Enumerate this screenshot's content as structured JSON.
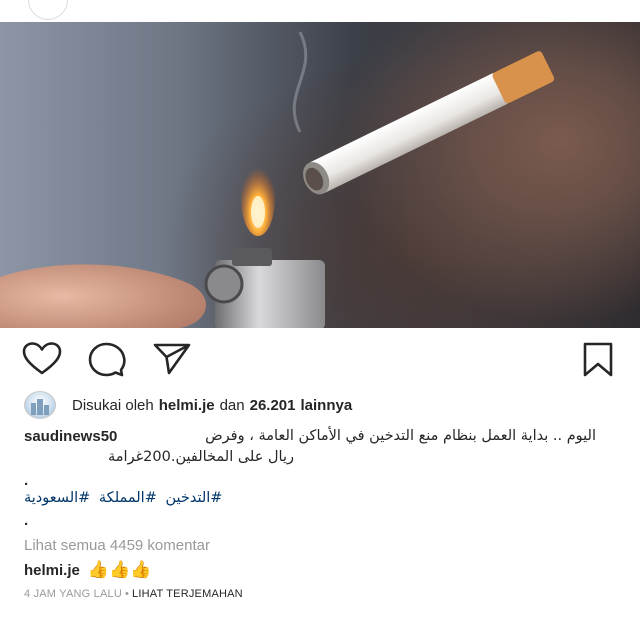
{
  "post": {
    "liked_by_prefix": "Disukai oleh",
    "liked_by_user": "helmi.je",
    "liked_by_and": "dan",
    "likes_count": "26.201",
    "likes_suffix": "lainnya",
    "caption_user": "saudinews50",
    "caption_line1": "اليوم .. بداية العمل بنظام منع التدخين في الأماكن العامة ، وفرض",
    "caption_line2": "ريال على  المخالفين.200غرامة",
    "dot1": ".",
    "hashtags": [
      "#السعودية",
      "#المملكة",
      "#التدخين"
    ],
    "dot2": ".",
    "view_all_comments": "Lihat semua 4459 komentar",
    "comment_user": "helmi.je",
    "comment_text": "👍👍👍",
    "time_ago": "4 JAM YANG LALU",
    "separator": "•",
    "translate_label": "LIHAT TERJEMAHAN"
  },
  "icons": {
    "like": "heart-icon",
    "comment": "comment-bubble-icon",
    "share": "paper-plane-icon",
    "save": "bookmark-icon"
  },
  "colors": {
    "text": "#262626",
    "muted": "#999999",
    "hashtag": "#003569",
    "thumb": "#f2b423"
  }
}
